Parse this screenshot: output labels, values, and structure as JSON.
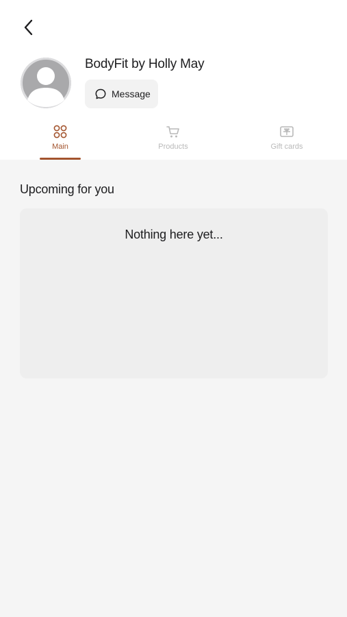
{
  "profile": {
    "name": "BodyFit by Holly May",
    "message_label": "Message"
  },
  "tabs": [
    {
      "label": "Main",
      "icon": "grid-icon",
      "active": true
    },
    {
      "label": "Products",
      "icon": "cart-icon",
      "active": false
    },
    {
      "label": "Gift cards",
      "icon": "gift-card-icon",
      "active": false
    }
  ],
  "upcoming": {
    "title": "Upcoming for you",
    "empty_text": "Nothing here yet..."
  },
  "colors": {
    "accent": "#a3542e",
    "inactive": "#b9b9b9",
    "background": "#f5f5f5",
    "card": "#eeeeee"
  }
}
